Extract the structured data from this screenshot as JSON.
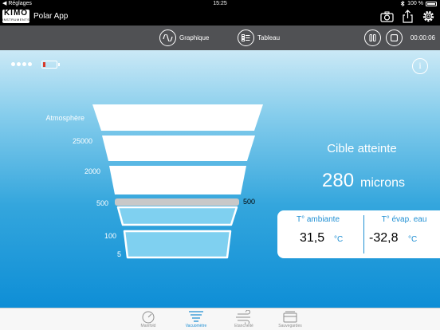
{
  "status_bar": {
    "back_label": "◀ Réglages",
    "time": "15:25",
    "battery": "100 %"
  },
  "app_header": {
    "logo_top": "KIMO",
    "logo_bottom": "INSTRUMENTS",
    "title": "Polar App"
  },
  "toolbar": {
    "graph_label": "Graphique",
    "table_label": "Tableau",
    "timer": "00:00:06"
  },
  "gauge": {
    "levels": [
      {
        "label": "Atmosphère"
      },
      {
        "label": "25000"
      },
      {
        "label": "2000"
      },
      {
        "label": "500"
      },
      {
        "label": "100"
      },
      {
        "label": "5"
      }
    ],
    "current_marker": "500"
  },
  "status_text": "Cible atteinte",
  "reading": {
    "value": "280",
    "unit": "microns"
  },
  "temperatures": {
    "ambient": {
      "title": "T° ambiante",
      "value": "31,5",
      "unit": "°C"
    },
    "evap": {
      "title": "T° évap. eau",
      "value": "-32,8",
      "unit": "°C"
    }
  },
  "tabs": [
    {
      "label": "Manifold"
    },
    {
      "label": "Vacuomètre"
    },
    {
      "label": "Etanchéité"
    },
    {
      "label": "Sauvegardes"
    }
  ],
  "colors": {
    "accent": "#1f8fd3",
    "toolbar": "#505154",
    "battery_low": "#d83a2a"
  },
  "info_icon": "i"
}
